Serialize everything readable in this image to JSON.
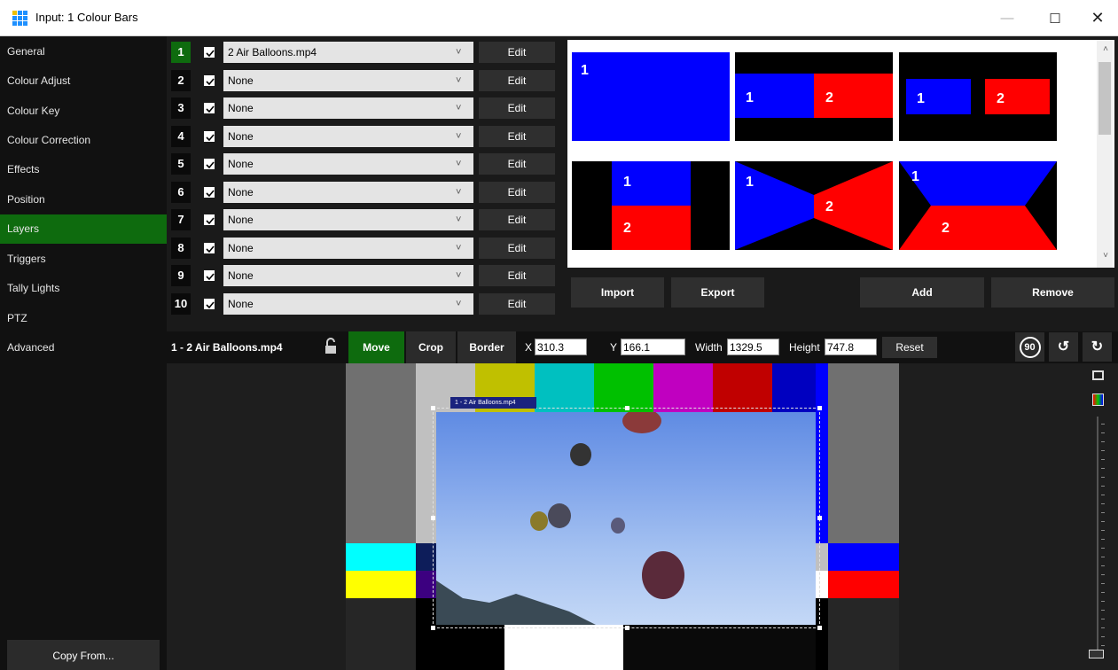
{
  "window": {
    "title": "Input: 1 Colour Bars",
    "minimize_glyph": "—",
    "maximize_glyph": "☐",
    "close_glyph": "✕"
  },
  "sidebar": {
    "items": [
      {
        "label": "General"
      },
      {
        "label": "Colour Adjust"
      },
      {
        "label": "Colour Key"
      },
      {
        "label": "Colour Correction"
      },
      {
        "label": "Effects"
      },
      {
        "label": "Position"
      },
      {
        "label": "Layers",
        "active": true
      },
      {
        "label": "Triggers"
      },
      {
        "label": "Tally Lights"
      },
      {
        "label": "PTZ"
      },
      {
        "label": "Advanced"
      }
    ],
    "copy_from_label": "Copy From..."
  },
  "layers": {
    "rows": [
      {
        "number": "1",
        "checked": true,
        "source": "2 Air Balloons.mp4",
        "edit_label": "Edit",
        "active": true
      },
      {
        "number": "2",
        "checked": true,
        "source": "None",
        "edit_label": "Edit"
      },
      {
        "number": "3",
        "checked": true,
        "source": "None",
        "edit_label": "Edit"
      },
      {
        "number": "4",
        "checked": true,
        "source": "None",
        "edit_label": "Edit"
      },
      {
        "number": "5",
        "checked": true,
        "source": "None",
        "edit_label": "Edit"
      },
      {
        "number": "6",
        "checked": true,
        "source": "None",
        "edit_label": "Edit"
      },
      {
        "number": "7",
        "checked": true,
        "source": "None",
        "edit_label": "Edit"
      },
      {
        "number": "8",
        "checked": true,
        "source": "None",
        "edit_label": "Edit"
      },
      {
        "number": "9",
        "checked": true,
        "source": "None",
        "edit_label": "Edit"
      },
      {
        "number": "10",
        "checked": true,
        "source": "None",
        "edit_label": "Edit"
      }
    ]
  },
  "presets": {
    "layer1_color": "#0000ff",
    "layer2_color": "#ff0000",
    "labels": {
      "one": "1",
      "two": "2"
    },
    "buttons": {
      "import": "Import",
      "export": "Export",
      "add": "Add",
      "remove": "Remove"
    }
  },
  "toolbar": {
    "title": "1 - 2 Air Balloons.mp4",
    "move_label": "Move",
    "crop_label": "Crop",
    "border_label": "Border",
    "x_label": "X",
    "x_value": "310.3",
    "y_label": "Y",
    "y_value": "166.1",
    "width_label": "Width",
    "width_value": "1329.5",
    "height_label": "Height",
    "height_value": "747.8",
    "reset_label": "Reset",
    "rotate90_glyph": "90"
  },
  "preview": {
    "selection_tag": "1 - 2 Air Balloons.mp4",
    "colour_bars": [
      "#c0c0c0",
      "#c0c000",
      "#00c0c0",
      "#00c000",
      "#c000c0",
      "#c00000",
      "#0000c0"
    ]
  }
}
